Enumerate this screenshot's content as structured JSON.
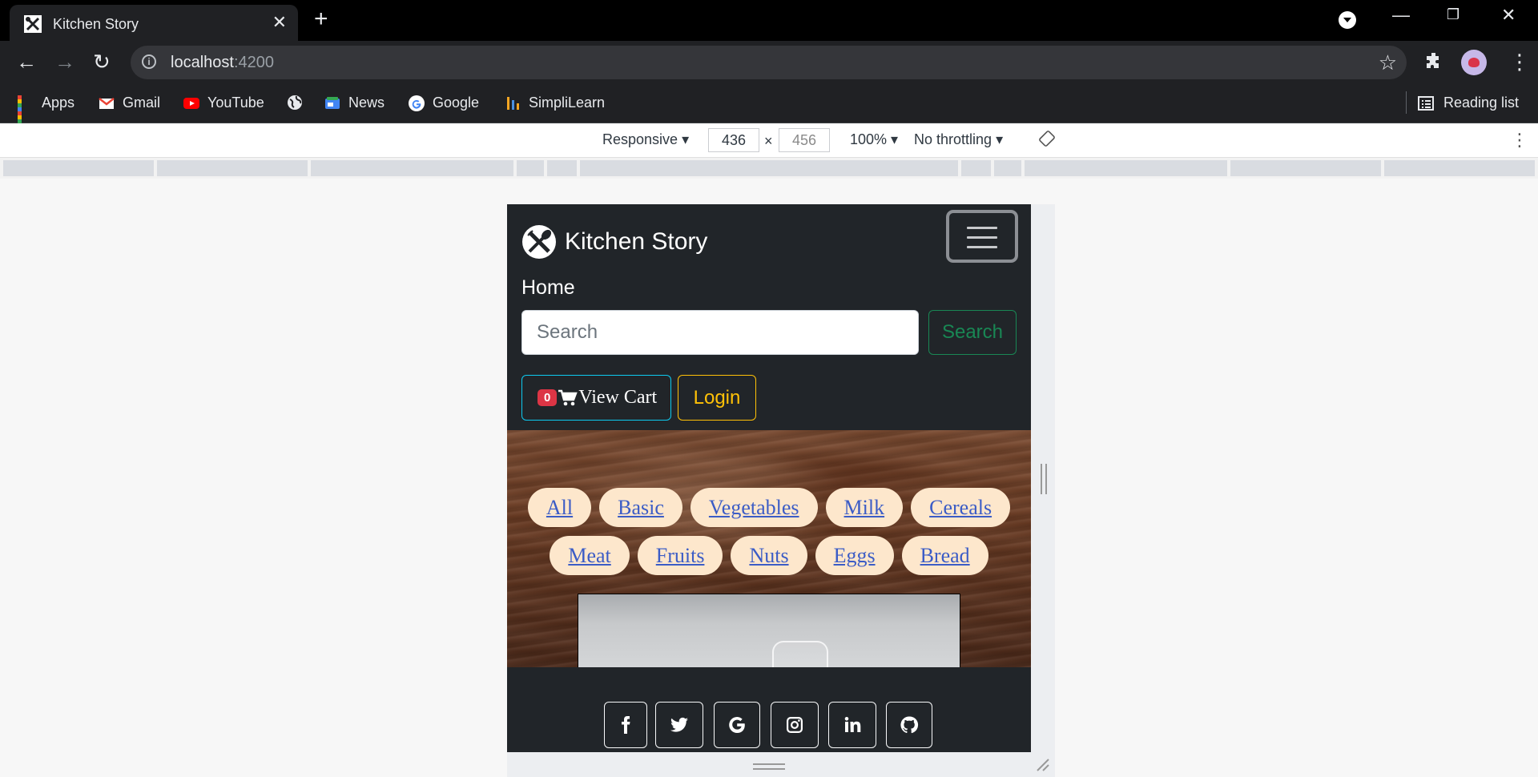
{
  "browser": {
    "tab_title": "Kitchen Story",
    "url_host": "localhost",
    "url_port": ":4200",
    "bookmarks": [
      "Apps",
      "Gmail",
      "YouTube",
      "News",
      "Google",
      "SimpliLearn"
    ],
    "reading_list": "Reading list"
  },
  "devtools": {
    "device": "Responsive",
    "width": "436",
    "times": "×",
    "height": "456",
    "zoom": "100%",
    "throttle": "No throttling"
  },
  "site": {
    "brand": "Kitchen Story",
    "nav_home": "Home",
    "search_placeholder": "Search",
    "search_button": "Search",
    "cart_count": "0",
    "cart_label": "View Cart",
    "login_label": "Login",
    "categories": [
      "All",
      "Basic",
      "Vegetables",
      "Milk",
      "Cereals",
      "Meat",
      "Fruits",
      "Nuts",
      "Eggs",
      "Bread"
    ],
    "social_icons": [
      "facebook-icon",
      "twitter-icon",
      "google-icon",
      "instagram-icon",
      "linkedin-icon",
      "github-icon"
    ]
  },
  "colors": {
    "navbar_bg": "#212529",
    "search_accent": "#198754",
    "cart_accent": "#0dcaf0",
    "login_accent": "#ffc107",
    "badge": "#dc3545",
    "category_pill": "#fde7cc",
    "category_link": "#3b5cc6"
  }
}
